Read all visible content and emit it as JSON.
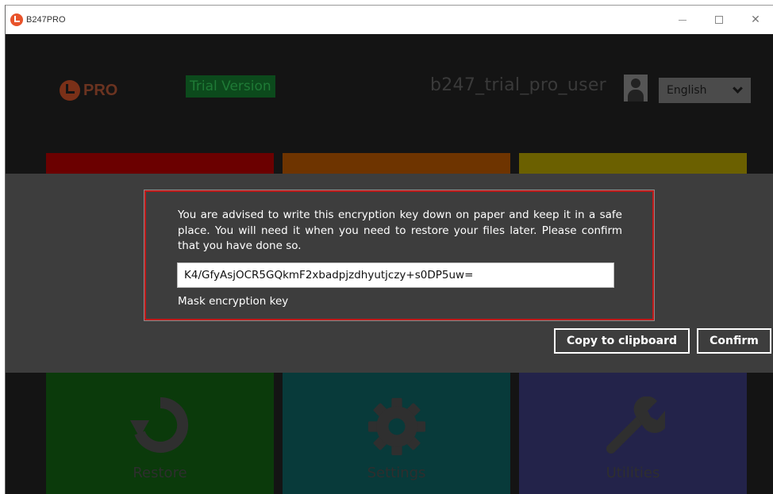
{
  "window": {
    "title": "B247PRO",
    "minimize_glyph": "—",
    "close_glyph": "✕"
  },
  "header": {
    "logo_text": "PRO",
    "trial_badge": "Trial Version",
    "username": "b247_trial_pro_user",
    "language": "English"
  },
  "tiles": [
    {
      "label": "Restore",
      "icon": "restore-icon"
    },
    {
      "label": "Settings",
      "icon": "gear-icon"
    },
    {
      "label": "Utilities",
      "icon": "wrench-icon"
    }
  ],
  "dialog": {
    "message": "You are advised to write this encryption key down on paper and keep it in a safe place. You will need it when you need to restore your files later. Please confirm that you have done so.",
    "encryption_key": "K4/GfyAsjOCR5GQkmF2xbadpjzdhyutjczy+s0DP5uw=",
    "mask_label": "Mask encryption key",
    "copy_button": "Copy to clipboard",
    "confirm_button": "Confirm"
  },
  "colors": {
    "highlight_border": "#c01a1a",
    "overlay": "#3d3d3d",
    "background": "#141414"
  }
}
